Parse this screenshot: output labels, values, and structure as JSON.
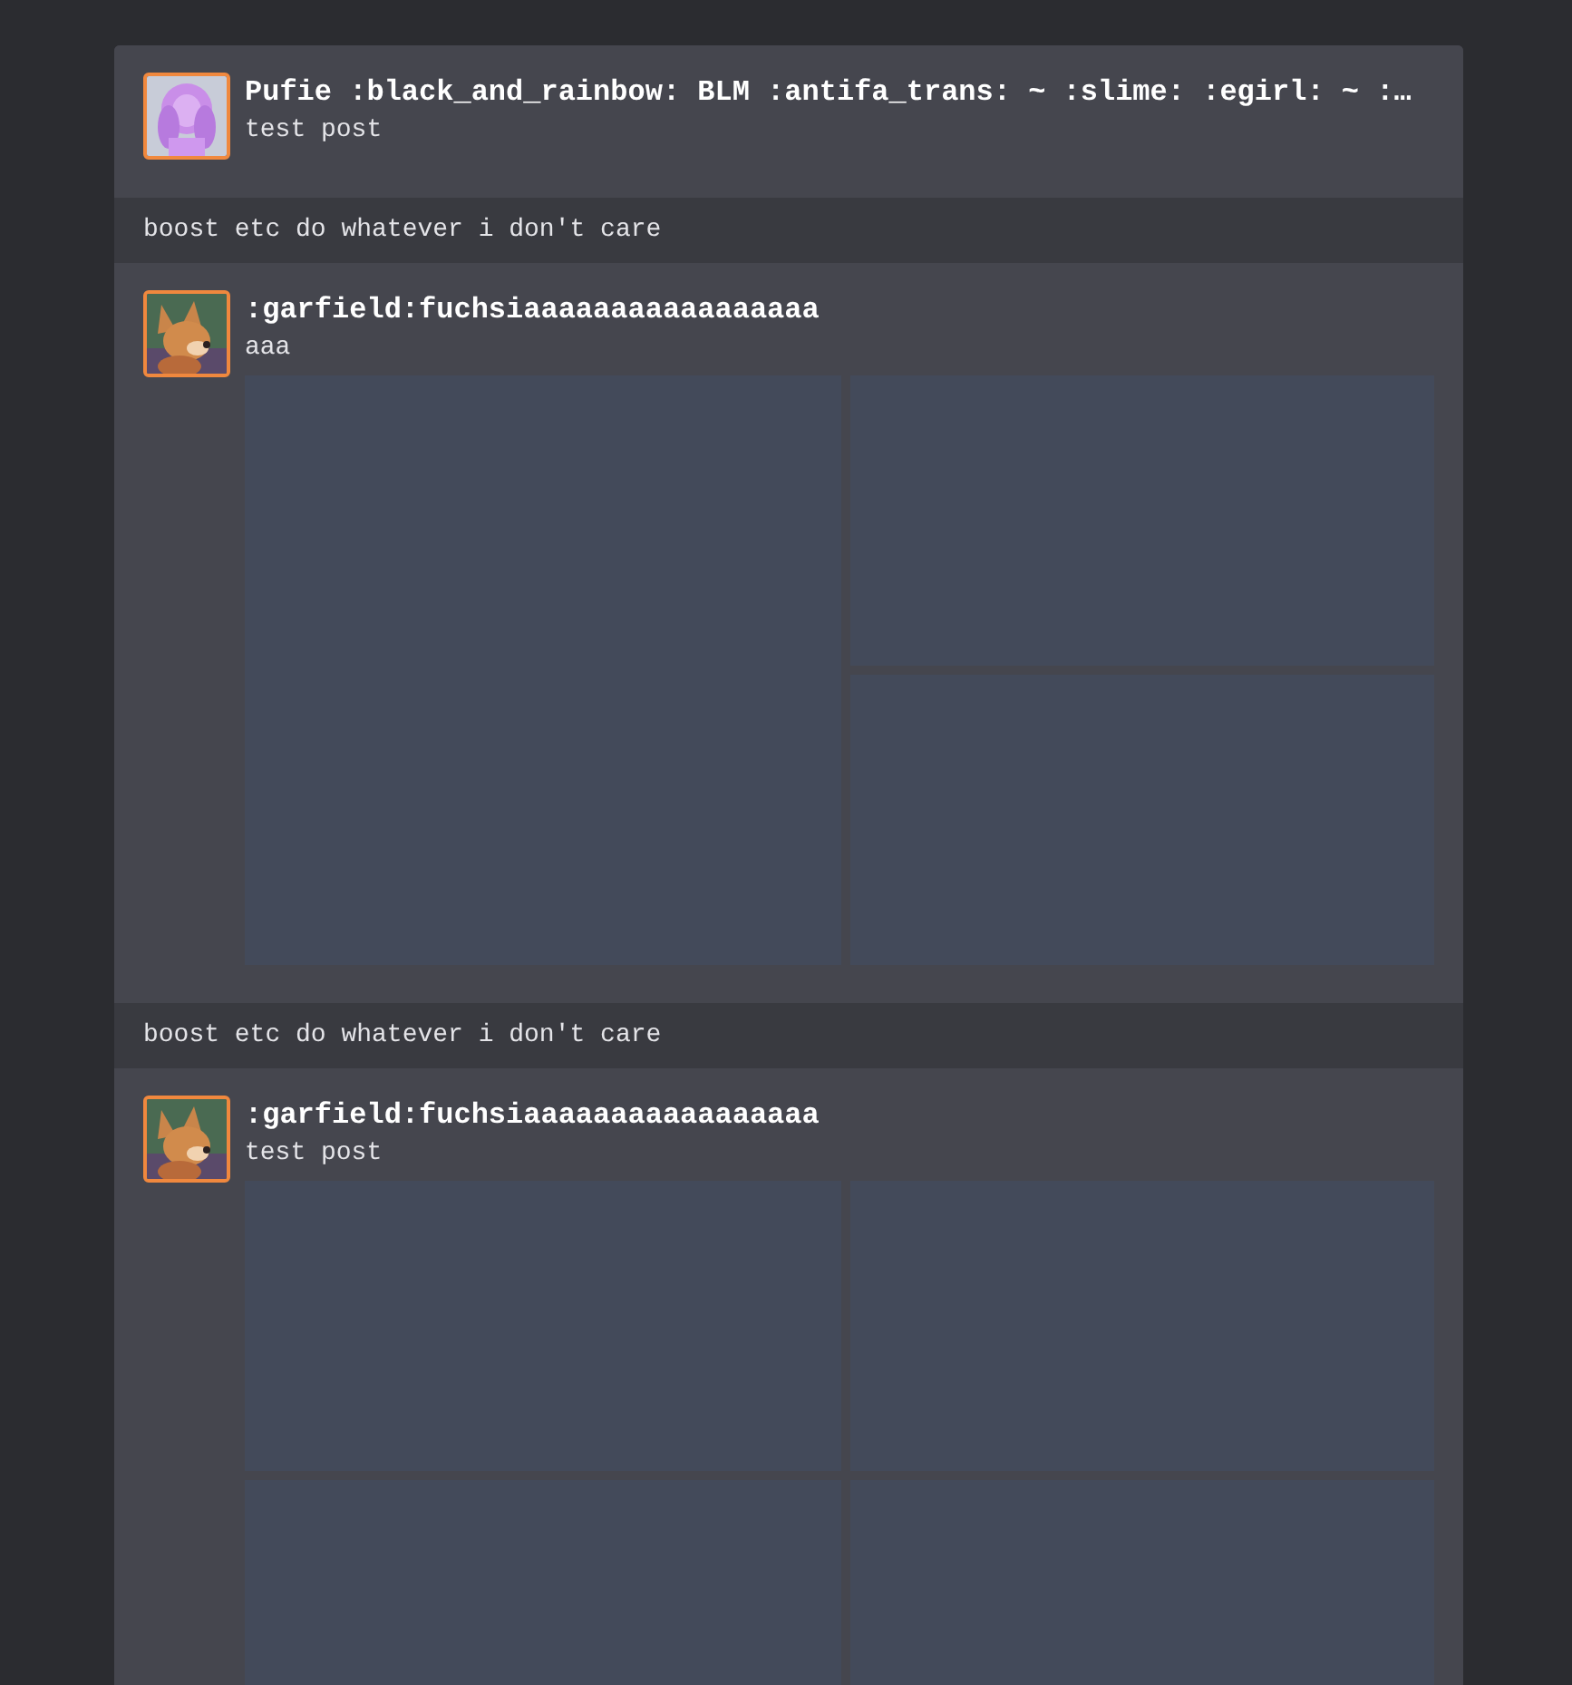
{
  "feed": [
    {
      "kind": "post",
      "author": "Pufie :black_and_rainbow: BLM :antifa_trans: ~ :slime: :egirl: ~ :…",
      "text": "test post",
      "avatar": {
        "kind": "figure"
      }
    },
    {
      "kind": "note",
      "text": "boost etc do whatever i don't care"
    },
    {
      "kind": "post",
      "author": ":garfield:fuchsiaaaaaaaaaaaaaaaaa",
      "text": "aaa",
      "avatar": {
        "kind": "animal"
      },
      "attachments": [
        {
          "kind": "tile"
        },
        {
          "kind": "tile"
        },
        {
          "kind": "tile"
        }
      ]
    },
    {
      "kind": "note",
      "text": "boost etc do whatever i don't care"
    },
    {
      "kind": "post",
      "author": ":garfield:fuchsiaaaaaaaaaaaaaaaaa",
      "text": "test post",
      "avatar": {
        "kind": "animal"
      },
      "attachments": [
        {
          "kind": "tile"
        },
        {
          "kind": "tile"
        },
        {
          "kind": "tile"
        },
        {
          "kind": "tile"
        }
      ]
    }
  ]
}
